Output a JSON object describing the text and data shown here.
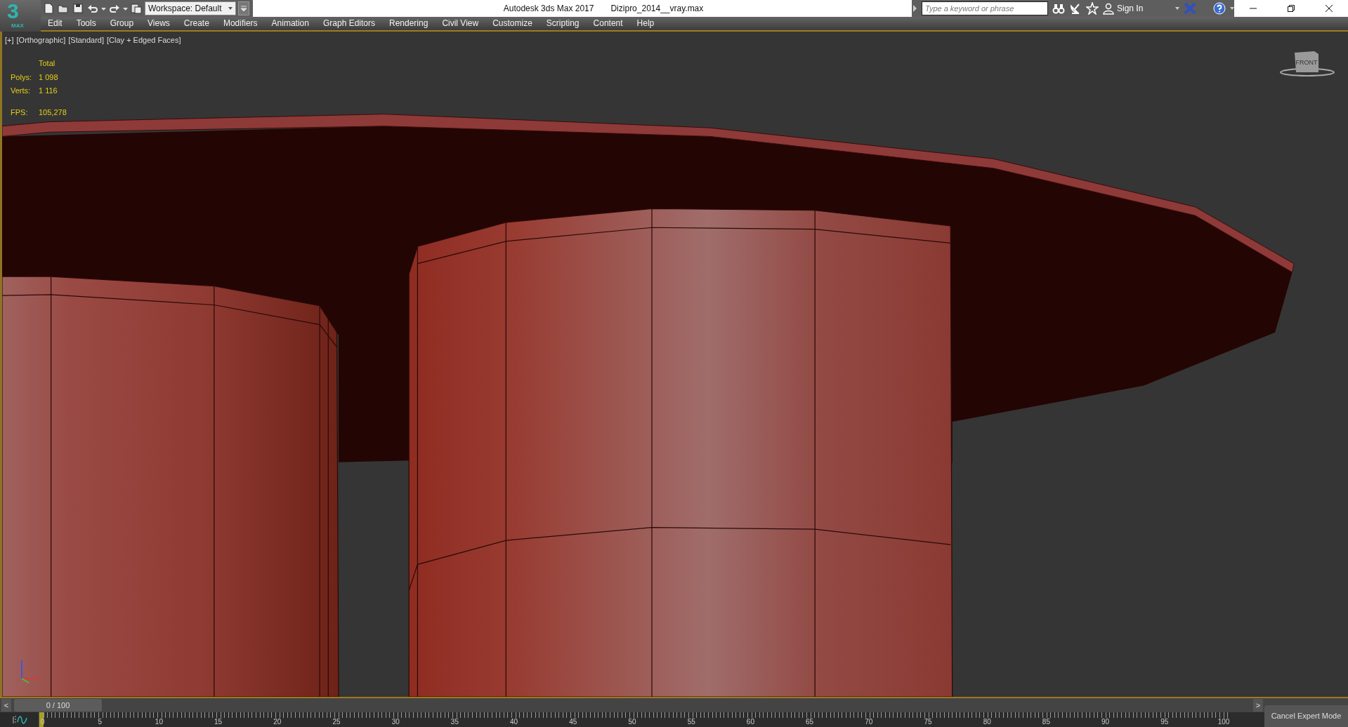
{
  "logo": {
    "numeral": "3",
    "sub": "MAX"
  },
  "titlebar": {
    "workspace": "Workspace: Default",
    "app_title": "Autodesk 3ds Max 2017",
    "file_name": "Dizipro_2014__vray.max",
    "search": {
      "placeholder": "Type a keyword or phrase"
    },
    "sign_in": "Sign In"
  },
  "menu": [
    "Edit",
    "Tools",
    "Group",
    "Views",
    "Create",
    "Modifiers",
    "Animation",
    "Graph Editors",
    "Rendering",
    "Civil View",
    "Customize",
    "Scripting",
    "Content",
    "Help"
  ],
  "viewport": {
    "labels": [
      "[+]",
      "[Orthographic]",
      "[Standard]",
      "[Clay + Edged Faces]"
    ],
    "stats": {
      "header": "Total",
      "rows": [
        {
          "label": "Polys:",
          "value": "1 098"
        },
        {
          "label": "Verts:",
          "value": "1 116"
        }
      ],
      "fps": {
        "label": "FPS:",
        "value": "105,278"
      }
    },
    "viewcube": "FRONT"
  },
  "timeline": {
    "prev": "<",
    "frame": "0 / 100",
    "next": ">",
    "ticks": [
      "0",
      "5",
      "10",
      "15",
      "20",
      "25",
      "30",
      "35",
      "40",
      "45",
      "50",
      "55",
      "60",
      "65",
      "70",
      "75",
      "80",
      "85",
      "90",
      "95",
      "100"
    ],
    "level": 0
  },
  "cancel_button": "Cancel Expert Mode"
}
